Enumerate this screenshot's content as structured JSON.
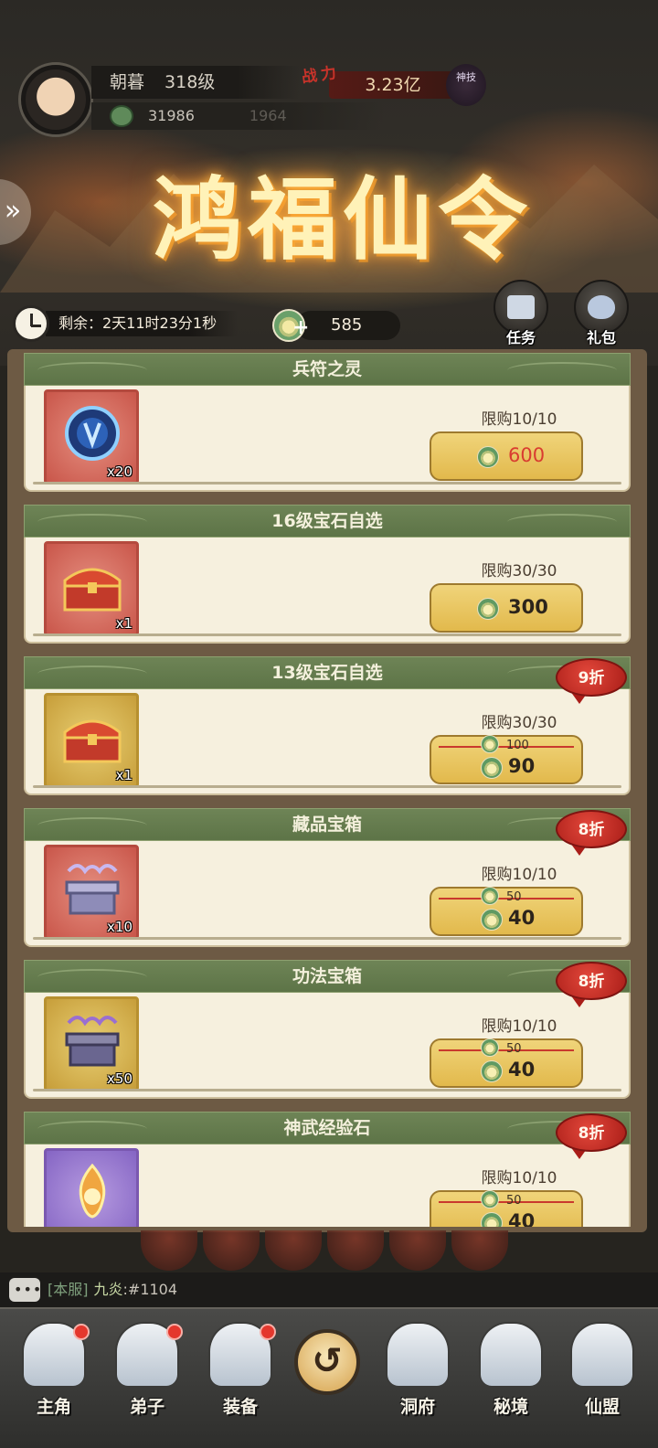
{
  "player": {
    "name": "朝暮",
    "level": "318级",
    "stat_value": "31986",
    "stat_faded": "1964"
  },
  "power": {
    "label": "战力",
    "value": "3.23亿",
    "badge": "神技"
  },
  "event": {
    "title": "鸿福仙令",
    "timer": "剩余：2天11时23分1秒",
    "currency_value": "585",
    "buttons": [
      {
        "label": "任务",
        "icon": "scroll-icon"
      },
      {
        "label": "礼包",
        "icon": "gift-bag-icon"
      }
    ]
  },
  "shop_items": [
    {
      "name": "兵符之灵",
      "qty": "x20",
      "limit": "限购10/10",
      "price": "600",
      "price_style": "red",
      "icon": "blue-token-icon",
      "frame": "red"
    },
    {
      "name": "16级宝石自选",
      "qty": "x1",
      "limit": "限购30/30",
      "price": "300",
      "icon": "treasure-chest-icon",
      "frame": "red"
    },
    {
      "name": "13级宝石自选",
      "qty": "x1",
      "limit": "限购30/30",
      "old_price": "100",
      "price": "90",
      "discount": "9折",
      "icon": "treasure-chest-icon",
      "frame": "gold"
    },
    {
      "name": "藏品宝箱",
      "qty": "x10",
      "limit": "限购10/10",
      "old_price": "50",
      "price": "40",
      "discount": "8折",
      "icon": "collection-chest-icon",
      "frame": "red"
    },
    {
      "name": "功法宝箱",
      "qty": "x50",
      "limit": "限购10/10",
      "old_price": "50",
      "price": "40",
      "discount": "8折",
      "icon": "skill-chest-icon",
      "frame": "gold"
    },
    {
      "name": "神武经验石",
      "qty": "",
      "limit": "限购10/10",
      "old_price": "50",
      "price": "40",
      "discount": "8折",
      "icon": "flame-stone-icon",
      "frame": "purple"
    }
  ],
  "chat": {
    "channel": "[本服]",
    "name": "九炎",
    "message": ":#1104"
  },
  "nav": [
    {
      "label": "主角",
      "icon": "hero-icon",
      "dot": true
    },
    {
      "label": "弟子",
      "icon": "disciple-icon",
      "dot": true
    },
    {
      "label": "装备",
      "icon": "equipment-icon",
      "dot": true
    },
    {
      "label": "洞府",
      "icon": "cave-icon",
      "dot": false
    },
    {
      "label": "秘境",
      "icon": "secret-realm-icon",
      "dot": false
    },
    {
      "label": "仙盟",
      "icon": "sect-icon",
      "dot": false
    }
  ],
  "colors": {
    "header_green": "#6e8456",
    "panel_cream": "#f6f0de",
    "price_gold": "#e2b94c",
    "discount_red": "#c9392d"
  }
}
